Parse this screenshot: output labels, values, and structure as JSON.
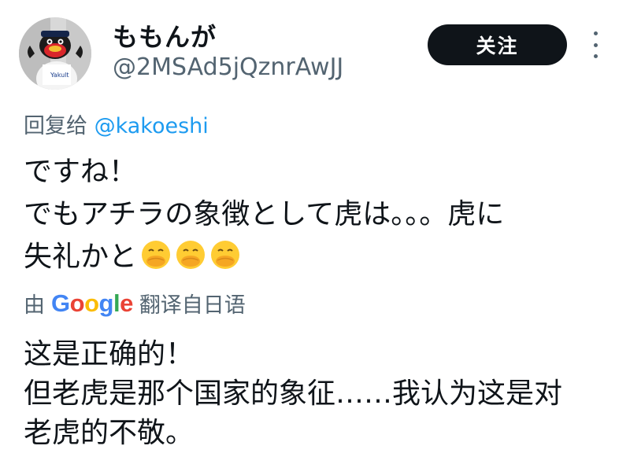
{
  "author": {
    "display_name": "ももんが",
    "handle": "@2MSAd5jQznrAwJJ",
    "avatar_icon": "mascot-avatar-icon"
  },
  "actions": {
    "follow_label": "关注",
    "more_icon": "more-dots-vertical-icon"
  },
  "reply": {
    "prefix": "回复给",
    "mention": "@kakoeshi"
  },
  "tweet": {
    "line1": "ですね！",
    "line2": "でもアチラの象徴として虎は。。。虎に",
    "line3": "失礼かと",
    "emoji_icon": "face-with-hand-over-mouth-emoji-icon",
    "emoji_count": 3
  },
  "translation_source": {
    "prefix": "由",
    "google": "Google",
    "suffix": "翻译自日语"
  },
  "translation": {
    "line1": "这是正确的！",
    "line2": "但老虎是那个国家的象征……我认为这是对",
    "line3": "老虎的不敬。"
  },
  "colors": {
    "accent": "#1d9bf0",
    "button_bg": "#0f1419",
    "secondary_text": "#536471"
  }
}
